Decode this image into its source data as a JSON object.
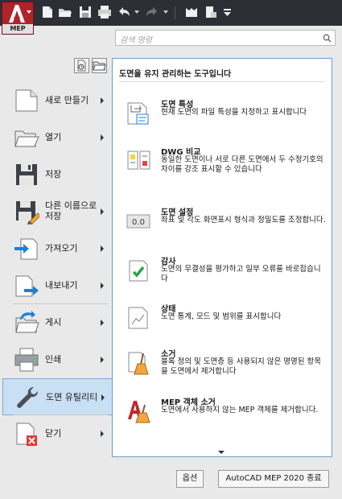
{
  "app": {
    "badge": "MEP",
    "brand_color": "#b0232a"
  },
  "quick_access": [
    {
      "icon": "new-icon"
    },
    {
      "icon": "open-icon"
    },
    {
      "icon": "save-icon"
    },
    {
      "icon": "print-icon"
    },
    {
      "icon": "undo-icon"
    },
    {
      "icon": "redo-icon"
    },
    {
      "icon": "workspace-icon"
    },
    {
      "icon": "properties-icon"
    },
    {
      "icon": "customize-dropdown-icon"
    }
  ],
  "search": {
    "placeholder": "검색 명령"
  },
  "left_menu": [
    {
      "label": "새로 만들기",
      "icon": "new-file-icon",
      "chevron": true,
      "selected": false
    },
    {
      "label": "열기",
      "icon": "folder-open-icon",
      "chevron": true,
      "selected": false
    },
    {
      "label": "저장",
      "icon": "floppy-icon",
      "chevron": false,
      "selected": false
    },
    {
      "label": "다른 이름으로 저장",
      "icon": "save-as-icon",
      "chevron": true,
      "selected": false
    },
    {
      "label": "가져오기",
      "icon": "import-icon",
      "chevron": true,
      "selected": false
    },
    {
      "label": "내보내기",
      "icon": "export-icon",
      "chevron": true,
      "selected": false
    },
    {
      "label": "게시",
      "icon": "publish-icon",
      "chevron": true,
      "selected": false
    },
    {
      "label": "인쇄",
      "icon": "printer-icon",
      "chevron": true,
      "selected": false
    },
    {
      "label": "도면 유틸리티",
      "icon": "wrench-icon",
      "chevron": true,
      "selected": true
    },
    {
      "label": "닫기",
      "icon": "close-file-icon",
      "chevron": true,
      "selected": false
    }
  ],
  "popup": {
    "title": "도면을 유지 관리하는 도구입니다",
    "items": [
      {
        "title": "도면 특성",
        "desc": "현재 도면의 파일 특성을 지정하고 표시합니다",
        "icon": "drawing-properties-icon"
      },
      {
        "title": "DWG 비교",
        "desc": "동일한 도면이나 서로 다른 도면에서 두 수정기호의 차이를 강조 표시할 수 있습니다",
        "icon": "dwg-compare-icon"
      },
      {
        "title": "도면 설정",
        "desc": "좌표 및 각도 화면표시 형식과 정밀도를 조정합니다.",
        "icon": "units-icon"
      },
      {
        "title": "감사",
        "desc": "도면의 무결성을 평가하고 일부 오류를 바로잡습니다",
        "icon": "audit-icon"
      },
      {
        "title": "상태",
        "desc": "도면 통계, 모드 및 범위를 표시합니다",
        "icon": "status-icon"
      },
      {
        "title": "소거",
        "desc": "블록 정의 및 도면층 등 사용되지 않은 명명된 항목을 도면에서 제거합니다",
        "icon": "purge-icon"
      },
      {
        "title": "MEP 객체 소거",
        "desc": "도면에서 사용하지 않는 MEP 객체를 제거합니다.",
        "icon": "mep-purge-icon"
      }
    ]
  },
  "buttons": {
    "options": "옵션",
    "exit": "AutoCAD MEP 2020 종료"
  }
}
